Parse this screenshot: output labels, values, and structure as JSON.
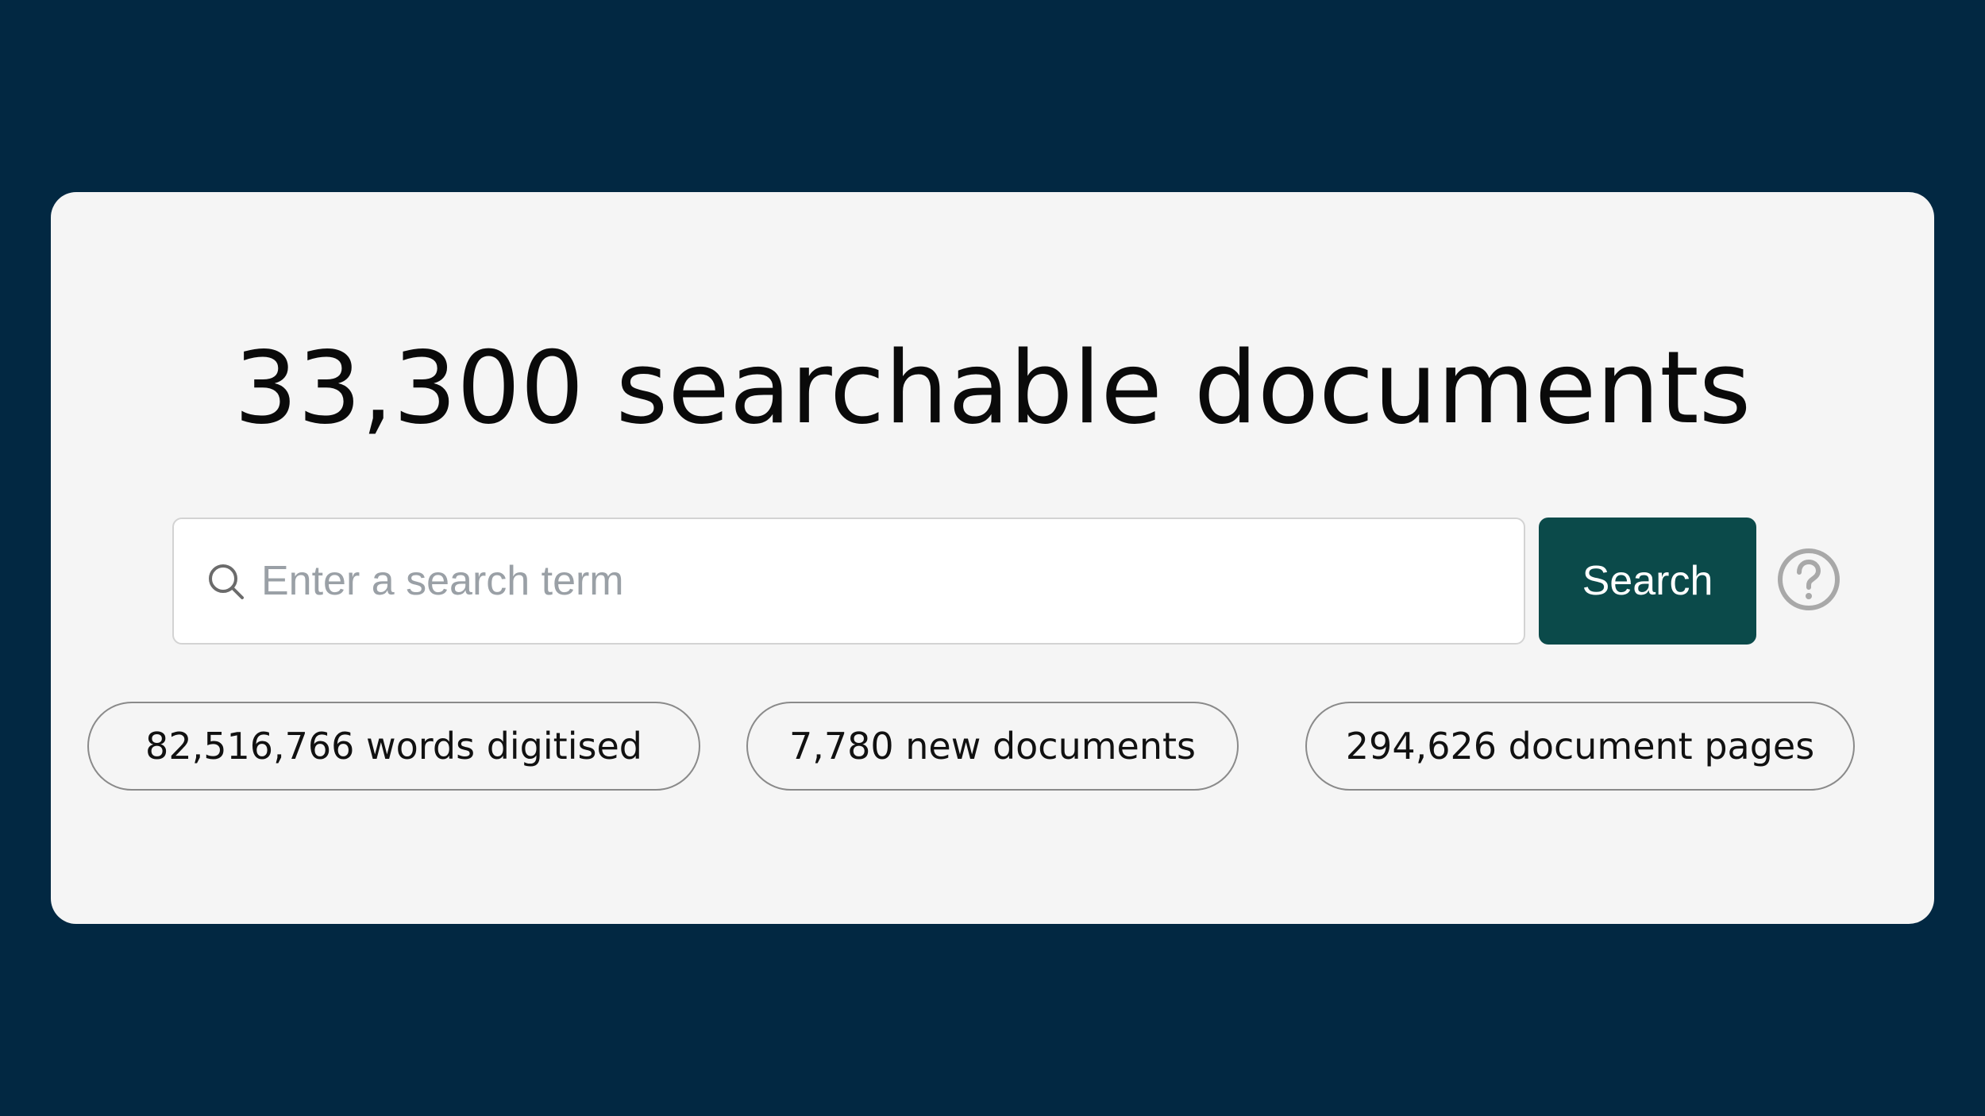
{
  "headline": "33,300 searchable documents",
  "search": {
    "placeholder": "Enter a search term",
    "value": "",
    "button_label": "Search"
  },
  "icons": {
    "search": "search-icon",
    "help": "question-circle-icon"
  },
  "stats": [
    {
      "label": "82,516,766 words digitised"
    },
    {
      "label": "7,780 new documents"
    },
    {
      "label": "294,626 document pages"
    }
  ],
  "colors": {
    "page_background": "#022842",
    "card_background": "#f5f5f5",
    "button_background": "#0b4a4a",
    "button_text": "#ffffff",
    "placeholder_text": "#9aa0a6"
  }
}
